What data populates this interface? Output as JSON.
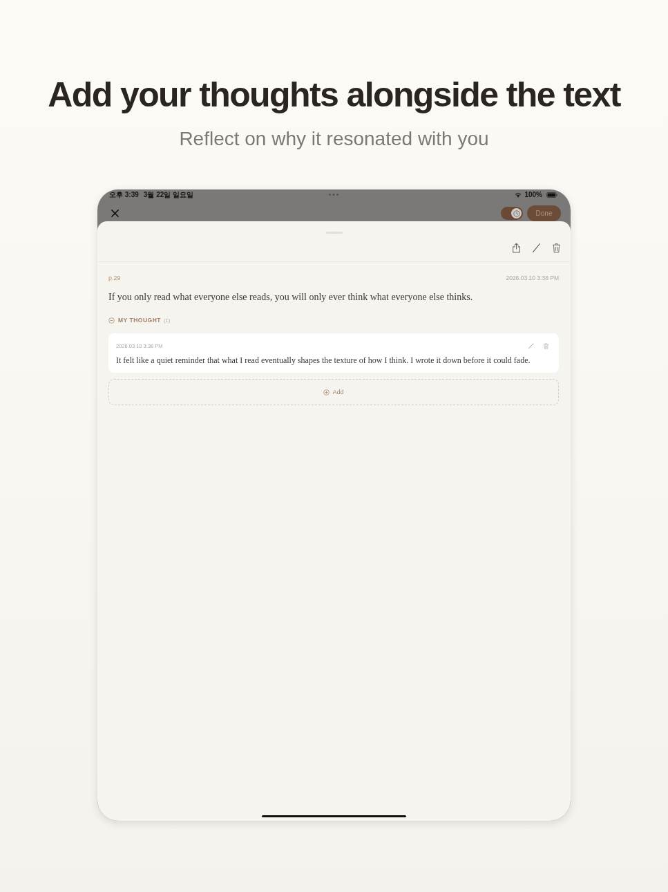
{
  "header": {
    "title": "Add your thoughts alongside the text",
    "subtitle": "Reflect on why it resonated with you"
  },
  "status_bar": {
    "time": "오후 3:39",
    "date": "3월 22일 일요일",
    "battery": "100%"
  },
  "nav_bar": {
    "timer_toggle": {
      "on": true
    },
    "done_button": "Done"
  },
  "highlight": {
    "page": "p.29",
    "date": "2026.03.10 3:38 PM",
    "quote": "If you only read what everyone else reads, you will only ever think what everyone else thinks."
  },
  "thoughts": {
    "label": "MY THOUGHT",
    "count": "(1)",
    "items": [
      {
        "date": "2026.03.10 3:38 PM",
        "text": "It felt like a quiet reminder that what I read eventually shapes the texture of how I think. I wrote it down before it could fade."
      }
    ],
    "add_button": "Add"
  }
}
